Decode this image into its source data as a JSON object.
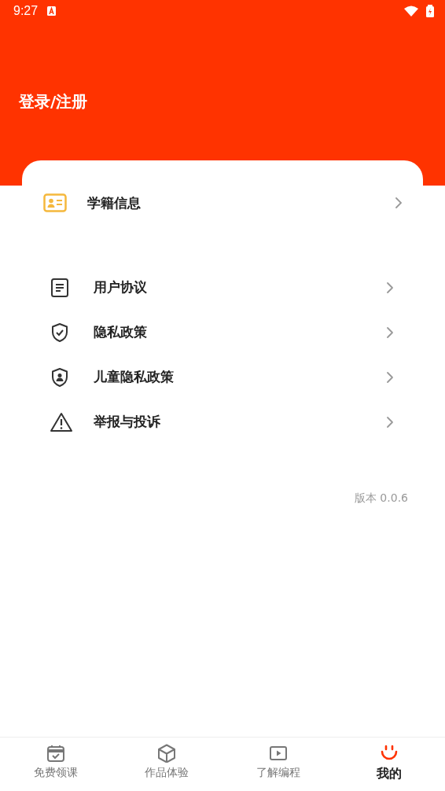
{
  "status_bar": {
    "time": "9:27"
  },
  "header": {
    "title": "登录/注册"
  },
  "student_info": {
    "label": "学籍信息"
  },
  "menu_items": [
    {
      "label": "用户协议"
    },
    {
      "label": "隐私政策"
    },
    {
      "label": "儿童隐私政策"
    },
    {
      "label": "举报与投诉"
    }
  ],
  "version": "版本 0.0.6",
  "tabs": [
    {
      "label": "免费领课",
      "selected": false
    },
    {
      "label": "作品体验",
      "selected": false
    },
    {
      "label": "了解编程",
      "selected": false
    },
    {
      "label": "我的",
      "selected": true
    }
  ]
}
